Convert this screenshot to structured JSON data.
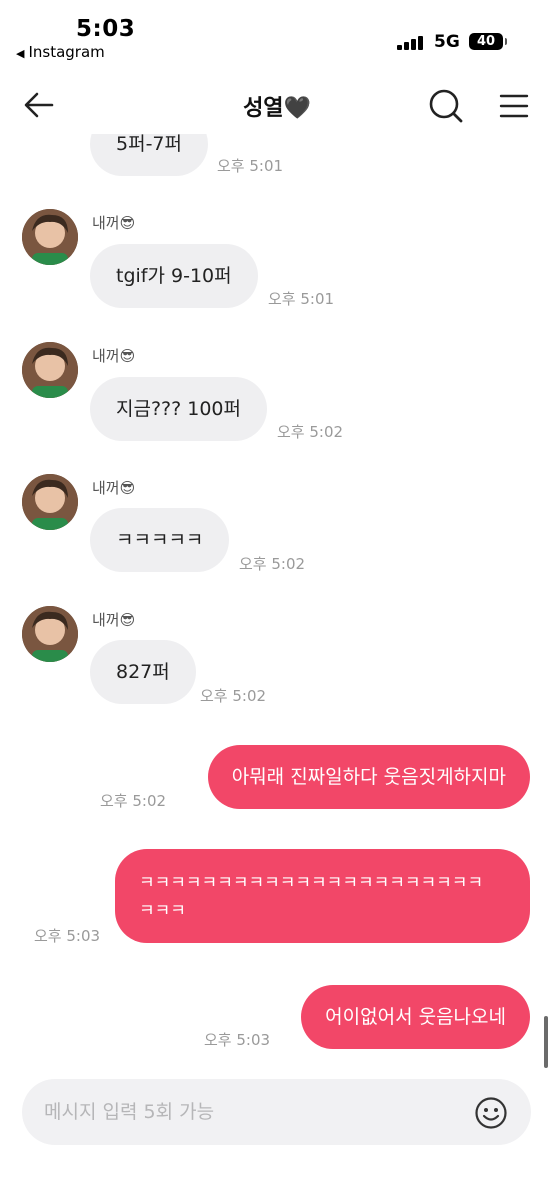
{
  "status_bar": {
    "time": "5:03",
    "back_app": "Instagram",
    "network": "5G",
    "battery": "40"
  },
  "header": {
    "title": "성열🖤"
  },
  "messages": [
    {
      "text": "5퍼-7퍼",
      "time": "오후 5:01"
    },
    {
      "sender": "내꺼😎",
      "text": "tgif가 9-10퍼",
      "time": "오후 5:01"
    },
    {
      "sender": "내꺼😎",
      "text": "지금??? 100퍼",
      "time": "오후 5:02"
    },
    {
      "sender": "내꺼😎",
      "text": "ㅋㅋㅋㅋㅋ",
      "time": "오후 5:02"
    },
    {
      "sender": "내꺼😎",
      "text": "827퍼",
      "time": "오후 5:02"
    },
    {
      "text": "아뭐래 진짜일하다 웃음짓게하지마",
      "time": "오후 5:02"
    },
    {
      "line1": "ㅋㅋㅋㅋㅋㅋㅋㅋㅋㅋㅋㅋㅋㅋㅋㅋㅋㅋㅋㅋㅋㅋ",
      "line2": "ㅋㅋㅋ",
      "time": "오후 5:03"
    },
    {
      "text": "어이없어서 웃음나오네",
      "time": "오후 5:03"
    }
  ],
  "input": {
    "placeholder": "메시지 입력 5회 가능"
  },
  "colors": {
    "outgoing_bubble": "#f24768",
    "incoming_bubble": "#efeff1"
  },
  "icons": {
    "back": "arrow-left-icon",
    "search": "search-icon",
    "menu": "menu-icon",
    "emoji": "smiley-icon"
  }
}
